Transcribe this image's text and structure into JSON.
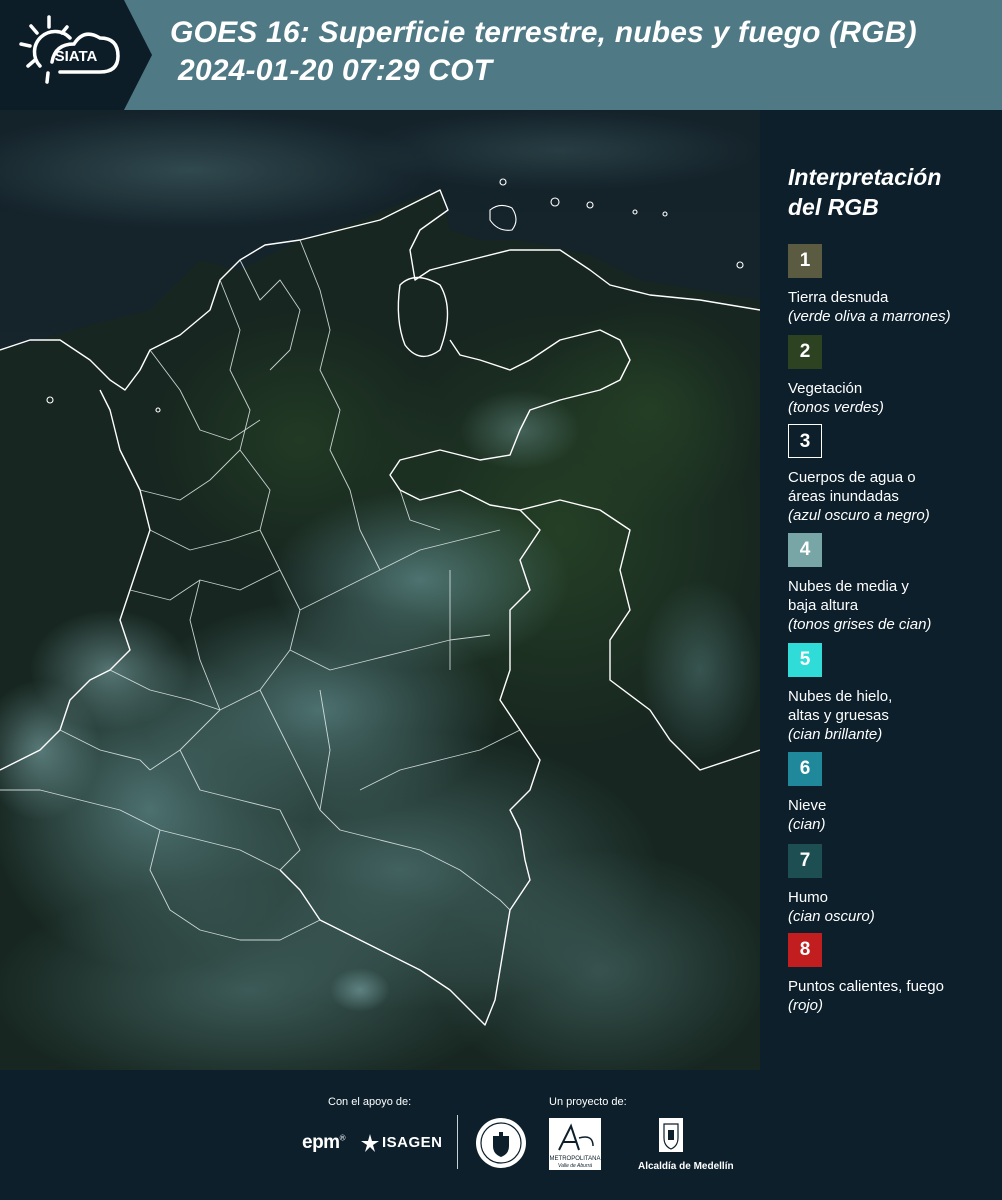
{
  "header": {
    "logo_text": "SIATA",
    "title_line1": "GOES 16: Superficie terrestre, nubes y fuego (RGB)",
    "title_line2": "2024-01-20 07:29 COT",
    "colors": {
      "band": "#4f7a85",
      "logo_bg": "#0d1d28"
    }
  },
  "map": {
    "icon": "satellite-map-image"
  },
  "legend": {
    "title_line1": "Interpretación",
    "title_line2": "del RGB",
    "items": [
      {
        "number": "1",
        "color": "#5b5b42",
        "name_lines": [
          "Tierra desnuda"
        ],
        "desc": "(verde oliva a marrones)"
      },
      {
        "number": "2",
        "color": "#2c4221",
        "name_lines": [
          "Vegetación"
        ],
        "desc": "(tonos verdes)"
      },
      {
        "number": "3",
        "color": "#0c1f2b",
        "name_lines": [
          "Cuerpos de agua o",
          "áreas inundadas"
        ],
        "desc": "(azul oscuro a negro)"
      },
      {
        "number": "4",
        "color": "#78a6a6",
        "name_lines": [
          "Nubes de media y",
          "baja altura"
        ],
        "desc": "(tonos grises de cian)"
      },
      {
        "number": "5",
        "color": "#2fdcd8",
        "name_lines": [
          "Nubes de hielo,",
          "altas y gruesas"
        ],
        "desc": "(cian brillante)"
      },
      {
        "number": "6",
        "color": "#1f889b",
        "name_lines": [
          "Nieve"
        ],
        "desc": "(cian)"
      },
      {
        "number": "7",
        "color": "#1d4f52",
        "name_lines": [
          "Humo"
        ],
        "desc": "(cian oscuro)"
      },
      {
        "number": "8",
        "color": "#c21d1f",
        "name_lines": [
          "Puntos calientes, fuego"
        ],
        "desc": "(rojo)"
      }
    ]
  },
  "footer": {
    "support_label": "Con el apoyo de:",
    "project_label": "Un proyecto de:",
    "epm": "epm",
    "epm_mark": "®",
    "isagen": "ISAGEN",
    "metro_name": "METROPOLITANA",
    "metro_sub": "Valle de Aburrá",
    "alcaldia": "Alcaldía de Medellín"
  }
}
